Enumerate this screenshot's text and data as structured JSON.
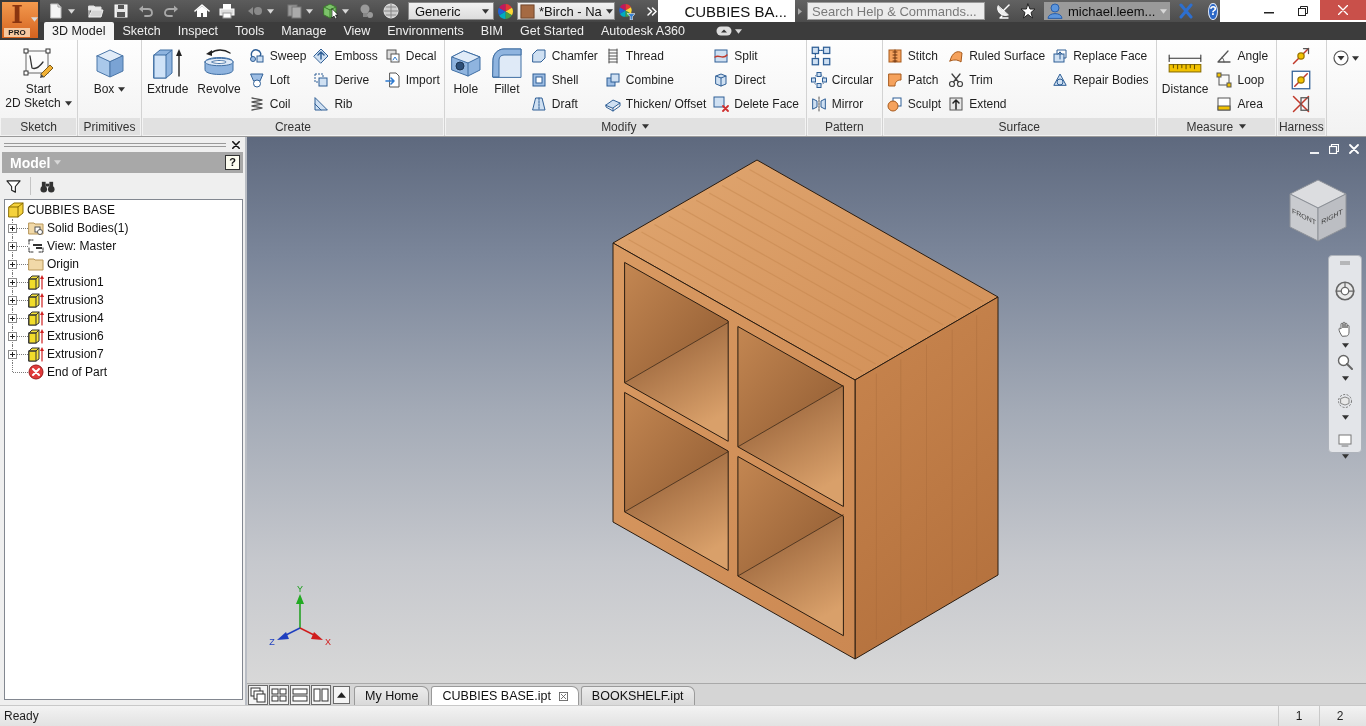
{
  "app_button": {
    "logo_letter": "I",
    "edition": "PRO"
  },
  "quick_access": {
    "appearance": "Generic",
    "material": "*Birch - Na"
  },
  "window": {
    "title": "CUBBIES BA..."
  },
  "help_bar": {
    "search_placeholder": "Search Help & Commands...",
    "user": "michael.leem...",
    "help_glyph": "?"
  },
  "ribbon_tabs": [
    {
      "label": "3D Model",
      "selected": true
    },
    {
      "label": "Sketch",
      "selected": false
    },
    {
      "label": "Inspect",
      "selected": false
    },
    {
      "label": "Tools",
      "selected": false
    },
    {
      "label": "Manage",
      "selected": false
    },
    {
      "label": "View",
      "selected": false
    },
    {
      "label": "Environments",
      "selected": false
    },
    {
      "label": "BIM",
      "selected": false
    },
    {
      "label": "Get Started",
      "selected": false
    },
    {
      "label": "Autodesk A360",
      "selected": false
    }
  ],
  "ribbon_panels": [
    {
      "title": "Sketch",
      "menu": false,
      "large_tools": [
        {
          "label": "Start\n2D Sketch",
          "dropdown": true
        }
      ]
    },
    {
      "title": "Primitives",
      "menu": false,
      "large_tools": [
        {
          "label": "Box",
          "dropdown": true
        }
      ]
    },
    {
      "title": "Create",
      "menu": false,
      "large_tools": [
        {
          "label": "Extrude",
          "dropdown": false
        },
        {
          "label": "Revolve",
          "dropdown": false
        }
      ],
      "columns": [
        [
          {
            "kind": "small",
            "label": "Sweep"
          },
          {
            "kind": "small",
            "label": "Loft"
          },
          {
            "kind": "small",
            "label": "Coil"
          }
        ],
        [
          {
            "kind": "small",
            "label": "Emboss"
          },
          {
            "kind": "small",
            "label": "Derive"
          },
          {
            "kind": "small",
            "label": "Rib"
          }
        ],
        [
          {
            "kind": "small",
            "label": "Decal"
          },
          {
            "kind": "small",
            "label": "Import"
          }
        ]
      ]
    },
    {
      "title": "Modify",
      "menu": true,
      "large_tools": [
        {
          "label": "Hole",
          "dropdown": false
        },
        {
          "label": "Fillet",
          "dropdown": false
        }
      ],
      "columns": [
        [
          {
            "kind": "small",
            "label": "Chamfer"
          },
          {
            "kind": "small",
            "label": "Shell"
          },
          {
            "kind": "small",
            "label": "Draft"
          }
        ],
        [
          {
            "kind": "small",
            "label": "Thread"
          },
          {
            "kind": "small",
            "label": "Combine"
          },
          {
            "kind": "small",
            "label": "Thicken/ Offset"
          }
        ],
        [
          {
            "kind": "small",
            "label": "Split"
          },
          {
            "kind": "small",
            "label": "Direct"
          },
          {
            "kind": "small",
            "label": "Delete Face"
          }
        ]
      ]
    },
    {
      "title": "Pattern",
      "menu": false,
      "columns": [
        [
          {
            "kind": "icon"
          },
          {
            "kind": "small",
            "label": "Circular"
          },
          {
            "kind": "small",
            "label": "Mirror"
          }
        ]
      ]
    },
    {
      "title": "Surface",
      "menu": false,
      "columns": [
        [
          {
            "kind": "small",
            "label": "Stitch"
          },
          {
            "kind": "small",
            "label": "Patch"
          },
          {
            "kind": "small",
            "label": "Sculpt"
          }
        ],
        [
          {
            "kind": "small",
            "label": "Ruled Surface"
          },
          {
            "kind": "small",
            "label": "Trim"
          },
          {
            "kind": "small",
            "label": "Extend"
          }
        ],
        [
          {
            "kind": "small",
            "label": "Replace Face"
          },
          {
            "kind": "small",
            "label": "Repair Bodies"
          }
        ]
      ]
    },
    {
      "title": "Measure",
      "menu": true,
      "large_tools": [
        {
          "label": "Distance",
          "dropdown": false
        }
      ],
      "columns": [
        [
          {
            "kind": "small",
            "label": "Angle"
          },
          {
            "kind": "small",
            "label": "Loop"
          },
          {
            "kind": "small",
            "label": "Area"
          }
        ]
      ]
    },
    {
      "title": "Harness",
      "menu": false,
      "columns": [
        [
          {
            "kind": "icon"
          },
          {
            "kind": "icon"
          },
          {
            "kind": "icon"
          }
        ]
      ]
    }
  ],
  "browser": {
    "title": "Model",
    "help_glyph": "?",
    "tree": [
      {
        "label": "CUBBIES BASE",
        "kind": "part",
        "children": [
          {
            "label": "Solid Bodies(1)",
            "kind": "bodies",
            "expanded": false
          },
          {
            "label": "View: Master",
            "kind": "view",
            "expanded": false
          },
          {
            "label": "Origin",
            "kind": "folder",
            "expanded": false
          },
          {
            "label": "Extrusion1",
            "kind": "feature",
            "expanded": false
          },
          {
            "label": "Extrusion3",
            "kind": "feature",
            "expanded": false
          },
          {
            "label": "Extrusion4",
            "kind": "feature",
            "expanded": false
          },
          {
            "label": "Extrusion6",
            "kind": "feature",
            "expanded": false
          },
          {
            "label": "Extrusion7",
            "kind": "feature",
            "expanded": false
          },
          {
            "label": "End of Part",
            "kind": "end"
          }
        ]
      }
    ]
  },
  "viewport": {
    "cube_faces": [
      "FRONT",
      "RIGHT"
    ],
    "axes": [
      "Y",
      "Z",
      "X"
    ]
  },
  "document_tabs": [
    {
      "label": "My Home",
      "selected": false
    },
    {
      "label": "CUBBIES BASE.ipt",
      "selected": true
    },
    {
      "label": "BOOKSHELF.ipt",
      "selected": false
    }
  ],
  "status_bar": {
    "message": "Ready",
    "cells": [
      "1",
      "2"
    ]
  }
}
